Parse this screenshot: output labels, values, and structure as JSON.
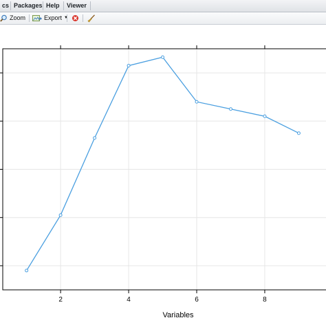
{
  "tabs": [
    {
      "label": "cs"
    },
    {
      "label": "Packages"
    },
    {
      "label": "Help"
    },
    {
      "label": "Viewer"
    }
  ],
  "toolbar": {
    "zoom_label": "Zoom",
    "export_label": "Export"
  },
  "colors": {
    "line": "#4a9fe0",
    "delete_icon": "#d9342b"
  },
  "chart_data": {
    "type": "line",
    "x": [
      1,
      2,
      3,
      4,
      5,
      6,
      7,
      8,
      9
    ],
    "series": [
      {
        "values": [
          0.08,
          0.31,
          0.63,
          0.93,
          0.965,
          0.78,
          0.75,
          0.72,
          0.65
        ]
      }
    ],
    "xlabel": "Variables",
    "ylabel": "",
    "xticks": [
      "2",
      "4",
      "6",
      "8"
    ],
    "xlim": [
      0.3,
      9.8
    ],
    "ylim": [
      0,
      1
    ],
    "grid": true
  }
}
